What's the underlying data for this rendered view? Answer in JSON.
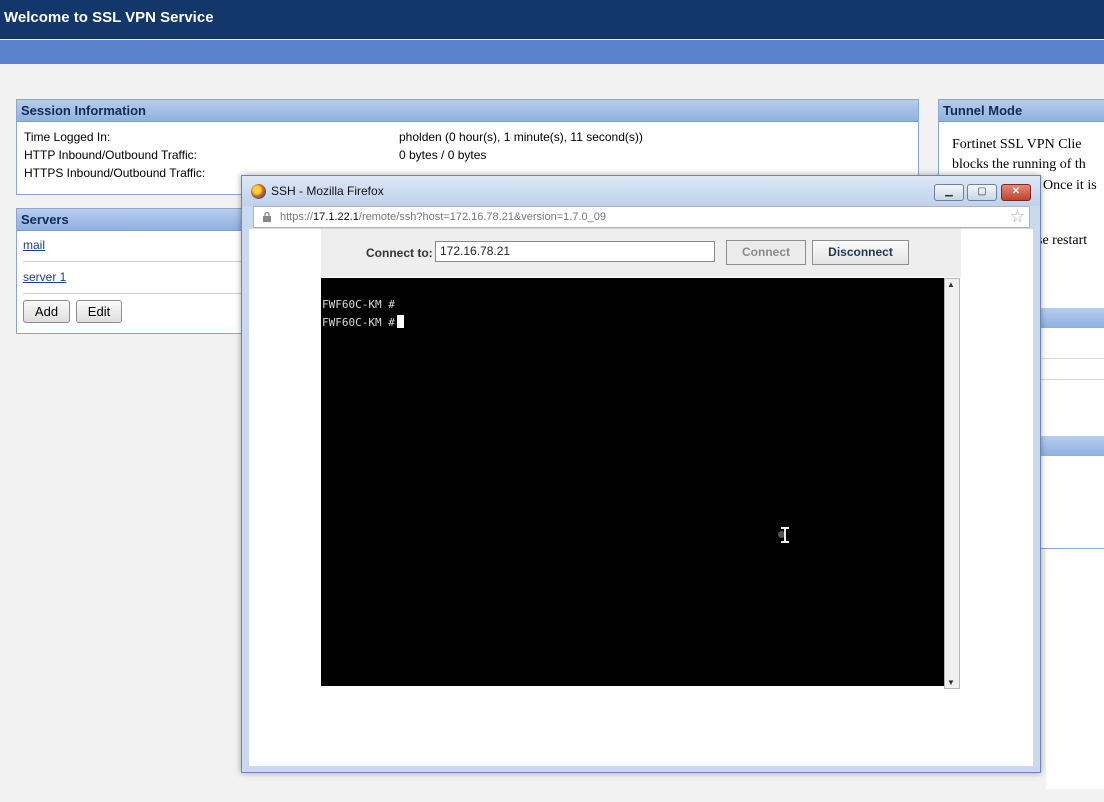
{
  "header": {
    "title": "Welcome to SSL VPN Service"
  },
  "session": {
    "title": "Session Information",
    "rows": [
      {
        "label": "Time Logged In:",
        "value": "pholden (0 hour(s), 1 minute(s), 11 second(s))"
      },
      {
        "label": "HTTP Inbound/Outbound Traffic:",
        "value": "0 bytes / 0 bytes"
      },
      {
        "label": "HTTPS Inbound/Outbound Traffic:",
        "value": ""
      }
    ]
  },
  "servers": {
    "title": "Servers",
    "items": [
      "mail",
      "server 1"
    ],
    "add_label": "Add",
    "edit_label": "Edit"
  },
  "tunnel": {
    "title": "Tunnel Mode",
    "lines": [
      "Fortinet SSL VPN Clie",
      "blocks the running of th",
      "Once it is",
      "se restart"
    ]
  },
  "popup": {
    "window_title": "SSH - Mozilla Firefox",
    "url_prefix": "https://",
    "url_host": "17.1.22.1",
    "url_path": "/remote/ssh?host=172.16.78.21&version=1.7.0_09",
    "connect_label": "Connect to:",
    "connect_value": "172.16.78.21",
    "connect_button": "Connect",
    "disconnect_button": "Disconnect",
    "terminal_lines": [
      "FWF60C-KM #",
      "FWF60C-KM #"
    ]
  }
}
